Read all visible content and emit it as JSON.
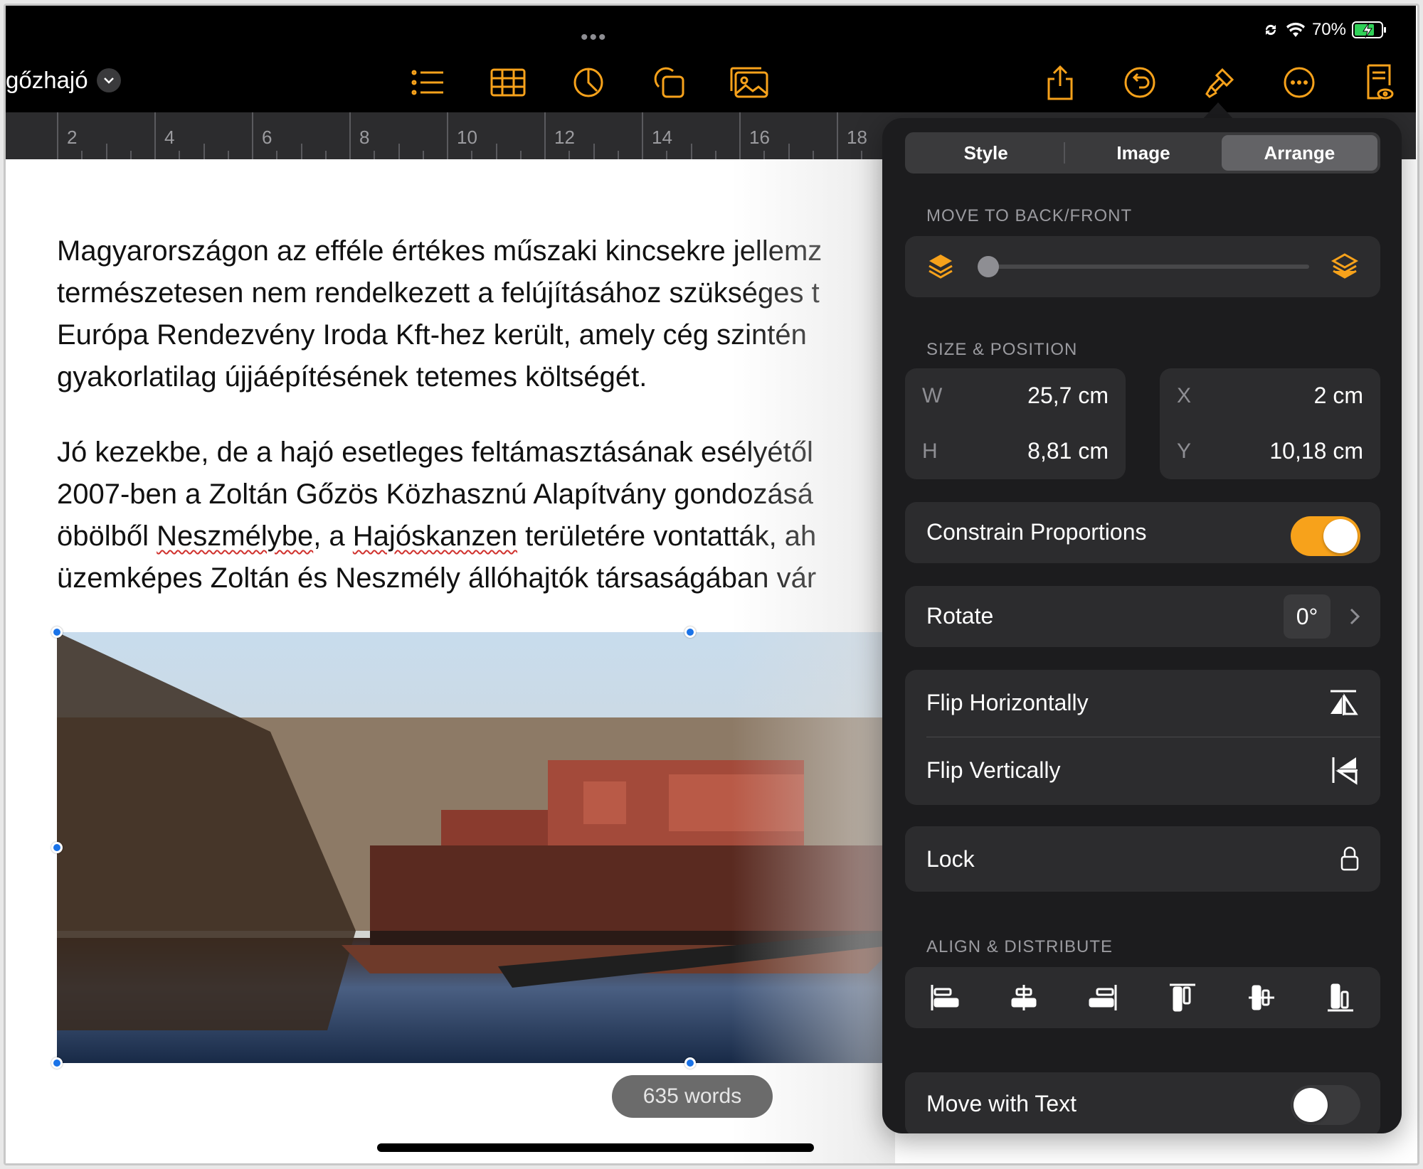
{
  "status_bar": {
    "battery_percent": "70%"
  },
  "document": {
    "title": "gőzhajó",
    "ruler_numbers": [
      "2",
      "4",
      "6",
      "8",
      "10",
      "12",
      "14",
      "16",
      "18"
    ],
    "paragraph1": [
      "Magyarországon az efféle értékes műszaki kincsekre jellemz",
      "természetesen nem rendelkezett a felújításához szükséges t",
      "Európa Rendezvény Iroda Kft-hez került, amely cég szintén",
      "gyakorlatilag újjáépítésének tetemes költségét."
    ],
    "paragraph2": {
      "line1": "Jó kezekbe, de a hajó esetleges feltámasztásának esélyétől",
      "line2": "2007-ben a Zoltán Gőzös Közhasznú Alapítvány gondozásá",
      "line3_a": "öbölből ",
      "line3_b": "Neszmélybe",
      "line3_c": ", a ",
      "line3_d": "Hajóskanzen",
      "line3_e": " területére vontatták, ah",
      "line4": "üzemképes Zoltán és Neszmély állóhajtók társaságában vár"
    },
    "word_count": "635 words"
  },
  "toolbar": {
    "icons": [
      "list-icon",
      "table-icon",
      "chart-icon",
      "shapes-icon",
      "media-icon",
      "share-icon",
      "undo-icon",
      "format-brush-icon",
      "more-icon",
      "document-view-icon"
    ]
  },
  "format_panel": {
    "tabs": [
      {
        "label": "Style",
        "active": false
      },
      {
        "label": "Image",
        "active": false
      },
      {
        "label": "Arrange",
        "active": true
      }
    ],
    "move_section": "MOVE TO BACK/FRONT",
    "move_level": 0,
    "size_section": "SIZE & POSITION",
    "size": {
      "w_label": "W",
      "w_value": "25,7 cm",
      "h_label": "H",
      "h_value": "8,81 cm",
      "x_label": "X",
      "x_value": "2 cm",
      "y_label": "Y",
      "y_value": "10,18 cm"
    },
    "constrain": {
      "label": "Constrain Proportions",
      "on": true
    },
    "rotate": {
      "label": "Rotate",
      "value": "0°"
    },
    "flip_h": "Flip Horizontally",
    "flip_v": "Flip Vertically",
    "lock": "Lock",
    "align_section": "ALIGN & DISTRIBUTE",
    "move_with_text": {
      "label": "Move with Text",
      "on": false
    }
  },
  "colors": {
    "accent": "#f7a21b",
    "selection": "#1a73e8",
    "panel_bg": "#1c1c1e",
    "card_bg": "#2c2c2e"
  }
}
